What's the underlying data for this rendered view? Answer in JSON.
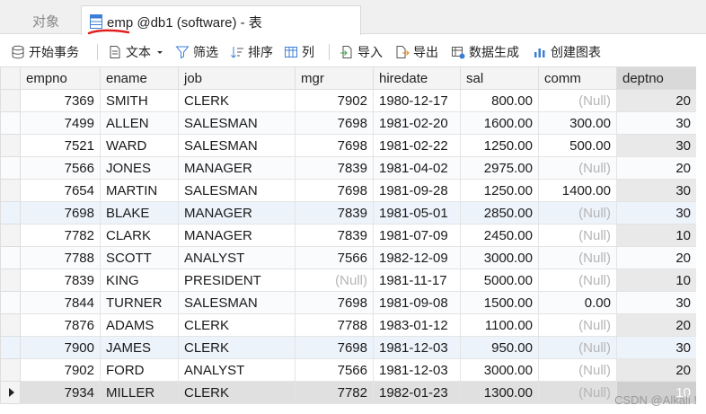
{
  "tabs": {
    "inactive_label": "对象",
    "active_label": "emp @db1 (software) - 表"
  },
  "toolbar": {
    "begin_transaction": "开始事务",
    "text": "文本",
    "filter": "筛选",
    "sort": "排序",
    "columns": "列",
    "import": "导入",
    "export": "导出",
    "generate_data": "数据生成",
    "create_chart": "创建图表"
  },
  "table": {
    "columns": [
      "empno",
      "ename",
      "job",
      "mgr",
      "hiredate",
      "sal",
      "comm",
      "deptno"
    ],
    "rows": [
      [
        "7369",
        "SMITH",
        "CLERK",
        "7902",
        "1980-12-17",
        "800.00",
        "(Null)",
        "20"
      ],
      [
        "7499",
        "ALLEN",
        "SALESMAN",
        "7698",
        "1981-02-20",
        "1600.00",
        "300.00",
        "30"
      ],
      [
        "7521",
        "WARD",
        "SALESMAN",
        "7698",
        "1981-02-22",
        "1250.00",
        "500.00",
        "30"
      ],
      [
        "7566",
        "JONES",
        "MANAGER",
        "7839",
        "1981-04-02",
        "2975.00",
        "(Null)",
        "20"
      ],
      [
        "7654",
        "MARTIN",
        "SALESMAN",
        "7698",
        "1981-09-28",
        "1250.00",
        "1400.00",
        "30"
      ],
      [
        "7698",
        "BLAKE",
        "MANAGER",
        "7839",
        "1981-05-01",
        "2850.00",
        "(Null)",
        "30"
      ],
      [
        "7782",
        "CLARK",
        "MANAGER",
        "7839",
        "1981-07-09",
        "2450.00",
        "(Null)",
        "10"
      ],
      [
        "7788",
        "SCOTT",
        "ANALYST",
        "7566",
        "1982-12-09",
        "3000.00",
        "(Null)",
        "20"
      ],
      [
        "7839",
        "KING",
        "PRESIDENT",
        "(Null)",
        "1981-11-17",
        "5000.00",
        "(Null)",
        "10"
      ],
      [
        "7844",
        "TURNER",
        "SALESMAN",
        "7698",
        "1981-09-08",
        "1500.00",
        "0.00",
        "30"
      ],
      [
        "7876",
        "ADAMS",
        "CLERK",
        "7788",
        "1983-01-12",
        "1100.00",
        "(Null)",
        "20"
      ],
      [
        "7900",
        "JAMES",
        "CLERK",
        "7698",
        "1981-12-03",
        "950.00",
        "(Null)",
        "30"
      ],
      [
        "7902",
        "FORD",
        "ANALYST",
        "7566",
        "1981-12-03",
        "3000.00",
        "(Null)",
        "20"
      ],
      [
        "7934",
        "MILLER",
        "CLERK",
        "7782",
        "1982-01-23",
        "1300.00",
        "(Null)",
        "10"
      ]
    ]
  },
  "watermark": "CSDN @Alkali !",
  "colors": {
    "underline_red": "#e02020",
    "table_icon_blue": "#3d7fd6",
    "null_gray": "#b5b5b5"
  }
}
